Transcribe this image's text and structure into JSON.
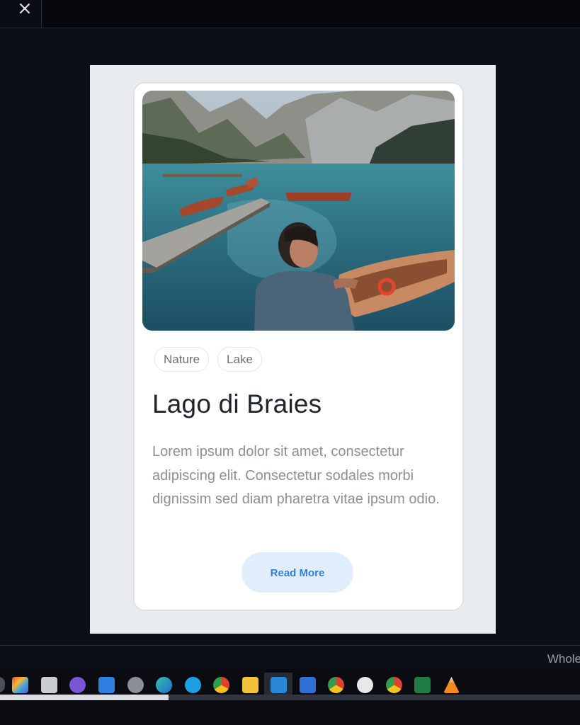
{
  "window": {
    "close_icon": "close-x-icon"
  },
  "card": {
    "image_alt": "Man sitting by a lake with wooden rowboats and a pier, mountains in background",
    "tags": [
      "Nature",
      "Lake"
    ],
    "title": "Lago di Braies",
    "description": "Lorem ipsum dolor sit amet, consectetur adipiscing elit. Consectetur sodales morbi dignissim sed diam pharetra vitae ipsum odio.",
    "button_label": "Read More"
  },
  "status": {
    "right_text": "Whole"
  },
  "taskbar": {
    "icons": [
      "circle-icon",
      "office-icon",
      "window-icon",
      "video-call-icon",
      "calendar-icon",
      "settings-gear-icon",
      "edge-browser-icon",
      "skype-icon",
      "chrome-icon",
      "file-explorer-icon",
      "vscode-icon",
      "todo-check-icon",
      "chrome-icon",
      "obs-icon",
      "chrome-canary-icon",
      "excel-icon",
      "vlc-icon"
    ],
    "progress_fraction": 0.29
  },
  "colors": {
    "page_bg": "#0c0f18",
    "stage_bg": "#e9ecef",
    "card_bg": "#ffffff",
    "button_bg": "#e0eefc",
    "button_text": "#2f7fe0"
  }
}
